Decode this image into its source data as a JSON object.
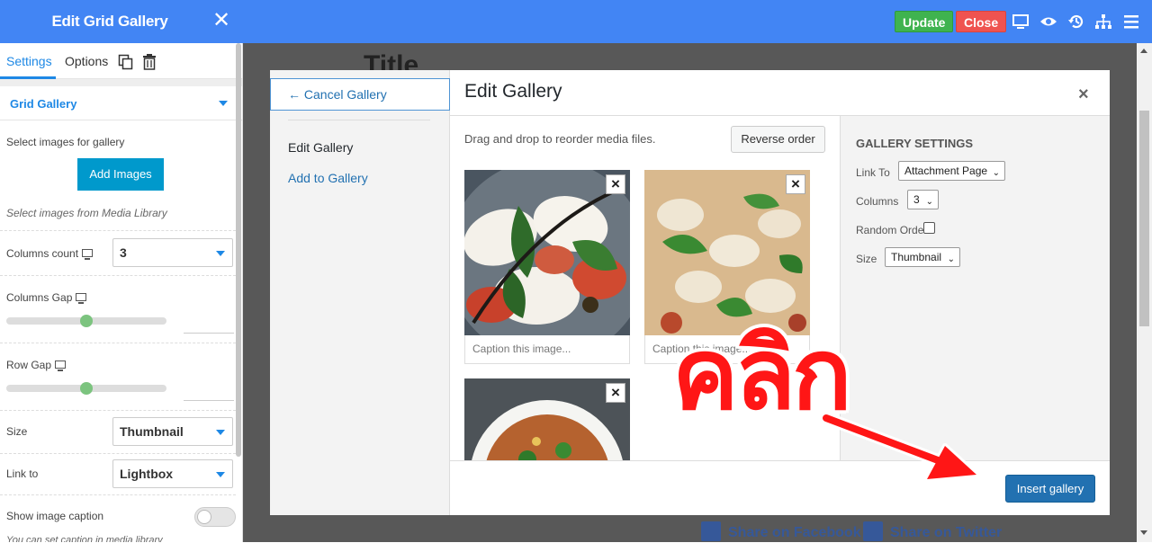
{
  "left_panel": {
    "title": "Edit Grid Gallery",
    "close_icon": "✕",
    "tabs": [
      "Settings",
      "Options"
    ],
    "section": "Grid Gallery",
    "select_images_label": "Select images for gallery",
    "add_images": "Add Images",
    "media_library_note": "Select images from Media Library",
    "columns_count_label": "Columns count",
    "columns_count_value": "3",
    "columns_gap_label": "Columns Gap",
    "row_gap_label": "Row Gap",
    "size_label": "Size",
    "size_value": "Thumbnail",
    "link_to_label": "Link to",
    "link_to_value": "Lightbox",
    "show_caption_label": "Show image caption",
    "caption_note": "You can set caption in media library",
    "collapse_icon": "‹"
  },
  "toolbar": {
    "update": "Update",
    "close": "Close",
    "icons": [
      "desktop-icon",
      "eye-icon",
      "history-icon",
      "sitemap-icon",
      "menu-icon"
    ]
  },
  "background": {
    "title": "Title",
    "share_facebook": "Share on Facebook",
    "share_twitter": "Share on Twitter"
  },
  "modal": {
    "cancel": "← Cancel Gallery",
    "menu": [
      "Edit Gallery",
      "Add to Gallery"
    ],
    "title": "Edit Gallery",
    "close_icon": "×",
    "instructions": "Drag and drop to reorder media files.",
    "reverse_order": "Reverse order",
    "remove_icon": "×",
    "caption_placeholder": "Caption this image...",
    "thumbnails": [
      {
        "name": "caprese-salad",
        "caption": "Caption this image..."
      },
      {
        "name": "mushroom-pizza",
        "caption": "Caption this image..."
      },
      {
        "name": "noodle-bowl",
        "caption": ""
      }
    ],
    "settings": {
      "heading": "GALLERY SETTINGS",
      "link_to_label": "Link To",
      "link_to_value": "Attachment Page",
      "columns_label": "Columns",
      "columns_value": "3",
      "random_order_label": "Random Order",
      "size_label": "Size",
      "size_value": "Thumbnail"
    },
    "insert": "Insert gallery"
  },
  "annotation": {
    "text": "คลิก",
    "color": "#ff1616"
  },
  "colors": {
    "accent": "#4285f4",
    "update": "#3fb34f",
    "close": "#ef5350",
    "wp_blue": "#2271b1"
  }
}
